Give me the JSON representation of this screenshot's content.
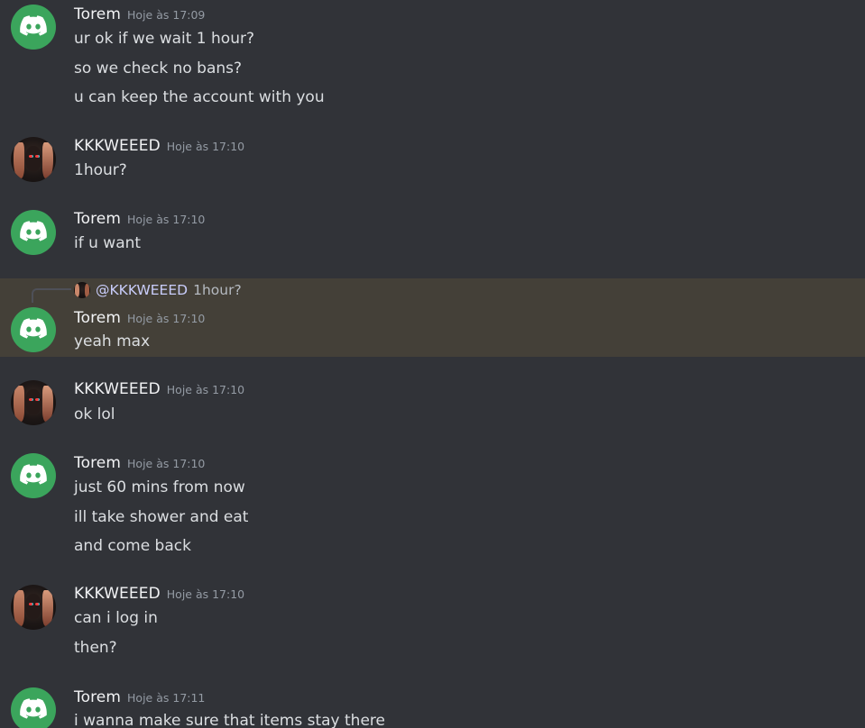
{
  "colors": {
    "background": "#313338",
    "highlight": "#444038",
    "bot_avatar": "#3ba55c",
    "username": "#f2f3f5",
    "timestamp": "#949ba4",
    "text": "#dbdee1"
  },
  "messages": [
    {
      "author": "Torem",
      "avatar": "discord-logo-icon",
      "time": "Hoje às 17:09",
      "lines": [
        "ur ok if we wait 1 hour?",
        "so we check no bans?",
        "u can keep the account with you"
      ]
    },
    {
      "author": "KKKWEEED",
      "avatar": "user-avatar",
      "time": "Hoje às 17:10",
      "lines": [
        "1hour?"
      ]
    },
    {
      "author": "Torem",
      "avatar": "discord-logo-icon",
      "time": "Hoje às 17:10",
      "lines": [
        "if u want"
      ]
    },
    {
      "author": "Torem",
      "avatar": "discord-logo-icon",
      "time": "Hoje às 17:10",
      "reply": {
        "mention": "@KKKWEEED",
        "text": "1hour?"
      },
      "lines": [
        "yeah max"
      ]
    },
    {
      "author": "KKKWEEED",
      "avatar": "user-avatar",
      "time": "Hoje às 17:10",
      "lines": [
        "ok lol"
      ]
    },
    {
      "author": "Torem",
      "avatar": "discord-logo-icon",
      "time": "Hoje às 17:10",
      "lines": [
        "just 60 mins from now",
        "ill take shower and eat",
        "and come back"
      ]
    },
    {
      "author": "KKKWEEED",
      "avatar": "user-avatar",
      "time": "Hoje às 17:10",
      "lines": [
        "can i log in",
        "then?"
      ]
    },
    {
      "author": "Torem",
      "avatar": "discord-logo-icon",
      "time": "Hoje às 17:11",
      "lines": [
        "i wanna make sure that items stay there"
      ]
    }
  ]
}
